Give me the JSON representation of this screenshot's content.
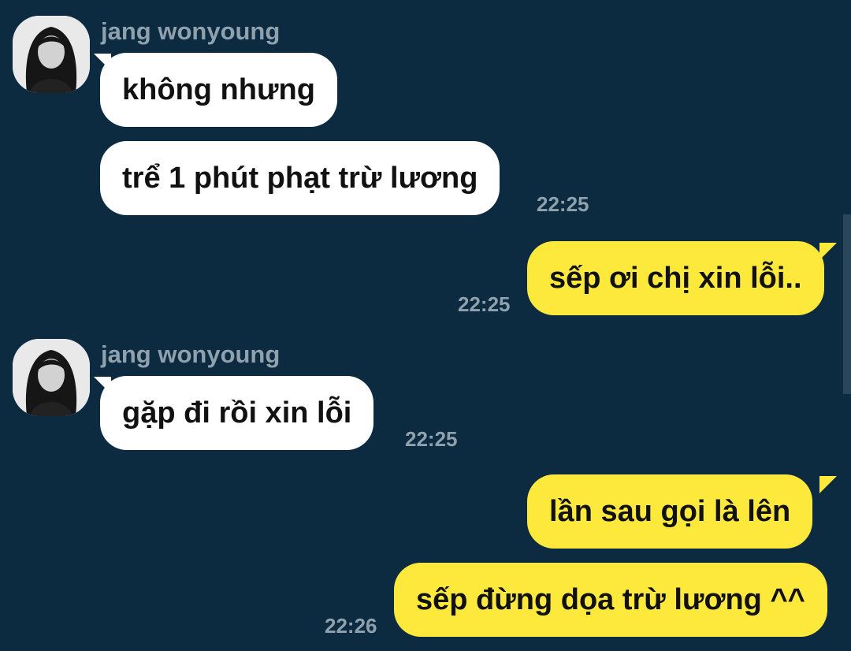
{
  "conversation": {
    "contact_name": "jang wonyoung",
    "messages": [
      {
        "direction": "incoming",
        "text": "không nhưng"
      },
      {
        "direction": "incoming",
        "text": "trể 1 phút phạt trừ lương",
        "time": "22:25"
      },
      {
        "direction": "outgoing",
        "text": "sếp ơi chị xin lỗi..",
        "time": "22:25"
      },
      {
        "direction": "incoming",
        "text": "gặp đi rồi xin lỗi",
        "time": "22:25"
      },
      {
        "direction": "outgoing",
        "text": "lần sau gọi là lên"
      },
      {
        "direction": "outgoing",
        "text": "sếp đừng dọa trừ lương ^^",
        "time": "22:26"
      }
    ]
  },
  "colors": {
    "background": "#0d2b40",
    "incoming_bubble": "#ffffff",
    "outgoing_bubble": "#fde93c",
    "meta_text": "#8ea1ad"
  },
  "icons": {
    "avatar": "profile-photo-avatar"
  }
}
